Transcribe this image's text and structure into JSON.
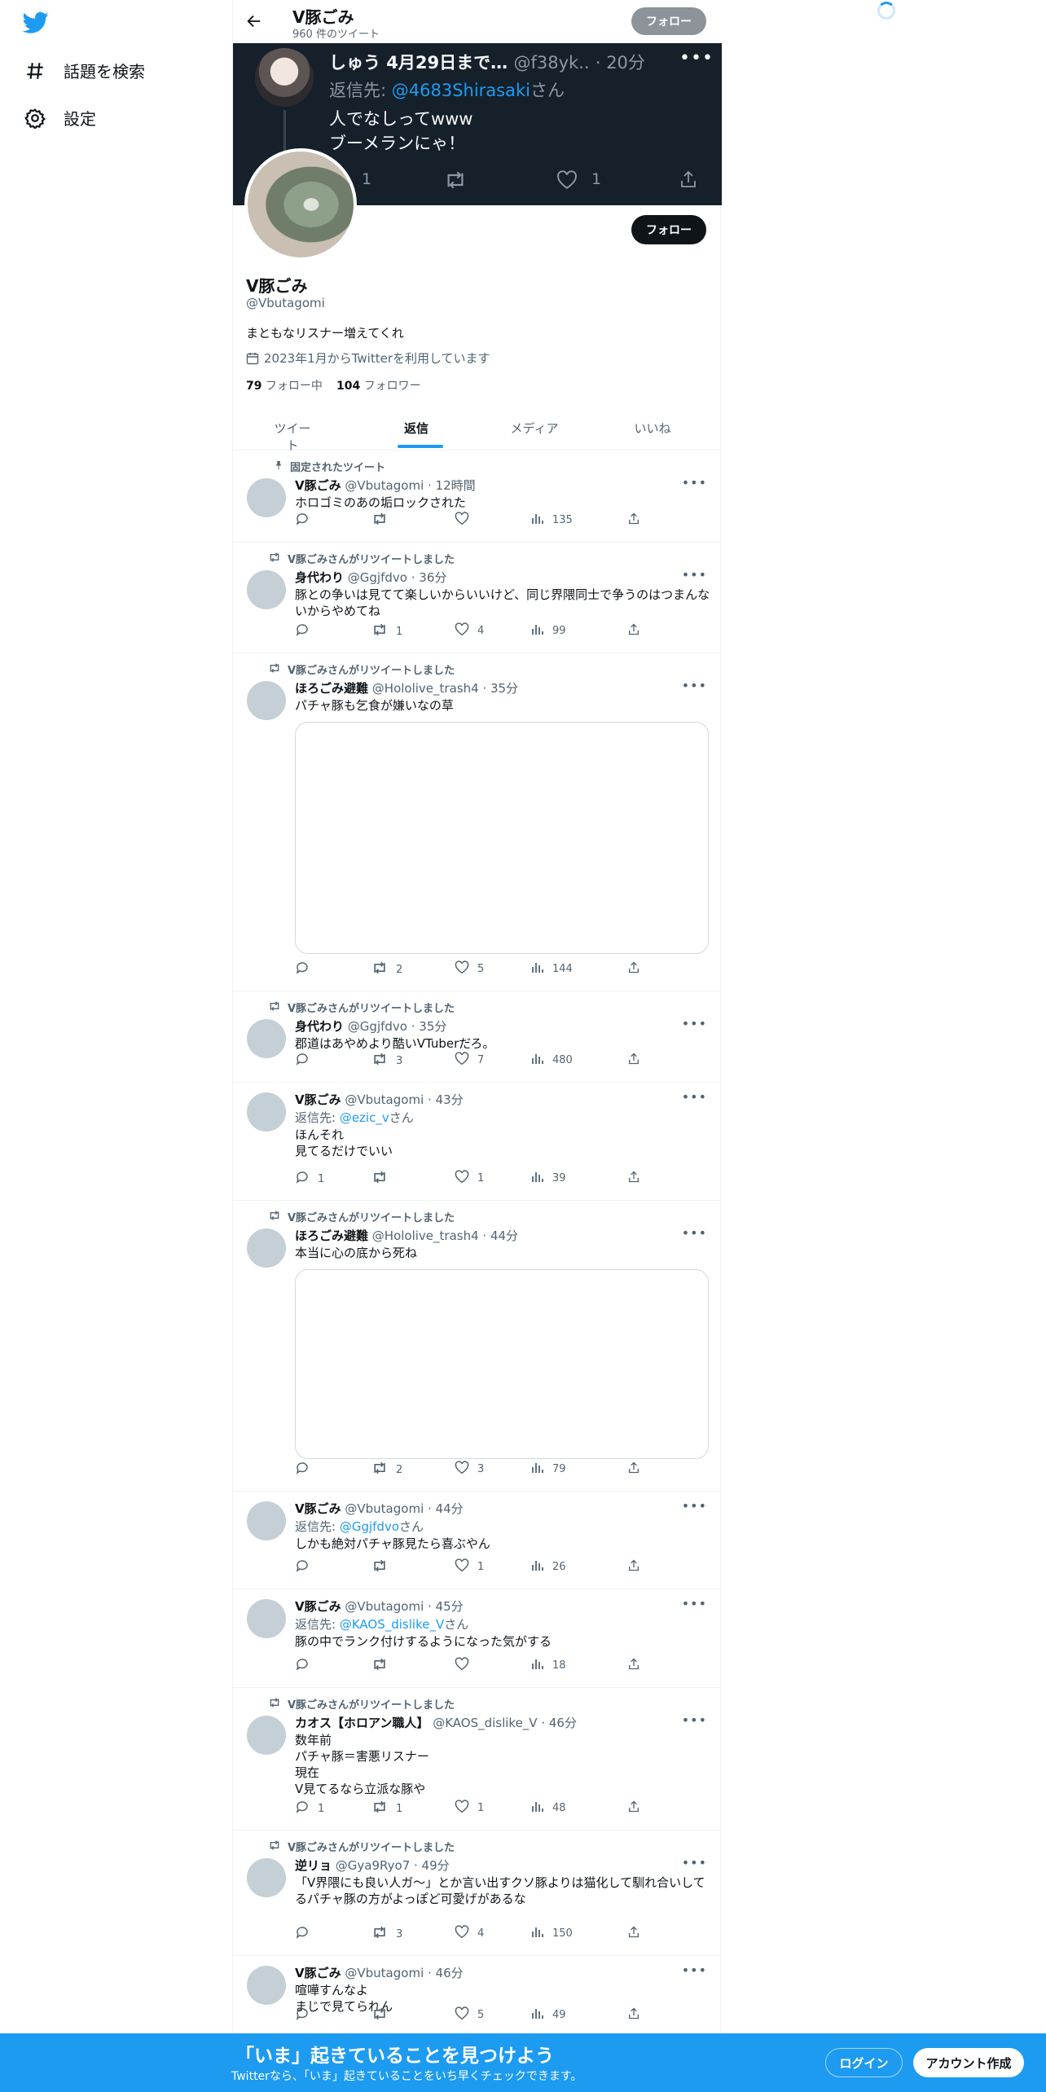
{
  "nav": {
    "explore_label": "話題を検索",
    "settings_label": "設定"
  },
  "header": {
    "name": "V豚ごみ",
    "tweet_count": "960 件のツイート",
    "follow_label": "フォロー"
  },
  "banner_tweet": {
    "name": "しゅう 4月29日まで…",
    "handle": "@f38yk..",
    "time": "· 20分",
    "reply_prefix": "返信先: ",
    "reply_to": "@4683Shirasaki",
    "reply_suffix": "さん",
    "line1": "人でなしってwww",
    "line2": "ブーメランにゃ！",
    "reply_count": "1",
    "like_count": "1"
  },
  "profile": {
    "follow_label": "フォロー",
    "name": "V豚ごみ",
    "handle": "@Vbutagomi",
    "bio": "まともなリスナー増えてくれ",
    "joined": "2023年1月からTwitterを利用しています",
    "following_count": "79",
    "following_label": "フォロー中",
    "followers_count": "104",
    "followers_label": "フォロワー"
  },
  "tabs": [
    "ツイート",
    "返信",
    "メディア",
    "いいね"
  ],
  "active_tab": "返信",
  "tweets": [
    {
      "context": "固定されたツイート",
      "name": "V豚ごみ",
      "meta": "@Vbutagomi · 12時間",
      "text": "ホロゴミのあの垢ロックされた",
      "replies": "",
      "retweets": "",
      "likes": "",
      "views": "135"
    },
    {
      "context": "V豚ごみさんがリツイートしました",
      "name": "身代わり",
      "meta": "@Ggjfdvo · 36分",
      "text": "豚との争いは見てて楽しいからいいけど、同じ界隈同士で争うのはつまんないからやめてね",
      "replies": "",
      "retweets": "1",
      "likes": "4",
      "views": "99"
    },
    {
      "context": "V豚ごみさんがリツイートしました",
      "name": "ほろごみ避難",
      "meta": "@Hololive_trash4 · 35分",
      "text": "パチャ豚も乞食が嫌いなの草",
      "replies": "",
      "retweets": "2",
      "likes": "5",
      "views": "144"
    },
    {
      "context": "V豚ごみさんがリツイートしました",
      "name": "身代わり",
      "meta": "@Ggjfdvo · 35分",
      "text": "郡道はあやめより酷いVTuberだろ。",
      "replies": "",
      "retweets": "3",
      "likes": "7",
      "views": "480"
    },
    {
      "context": "",
      "name": "V豚ごみ",
      "meta": "@Vbutagomi · 43分",
      "reply_prefix": "返信先: ",
      "reply_to": "@ezic_v",
      "reply_suffix": "さん",
      "text": "ほんそれ\n見てるだけでいい",
      "replies": "1",
      "retweets": "",
      "likes": "1",
      "views": "39"
    },
    {
      "context": "V豚ごみさんがリツイートしました",
      "name": "ほろごみ避難",
      "meta": "@Hololive_trash4 · 44分",
      "text": "本当に心の底から死ね",
      "replies": "",
      "retweets": "2",
      "likes": "3",
      "views": "79"
    },
    {
      "context": "",
      "name": "V豚ごみ",
      "meta": "@Vbutagomi · 44分",
      "reply_prefix": "返信先: ",
      "reply_to": "@Ggjfdvo",
      "reply_suffix": "さん",
      "text": "しかも絶対パチャ豚見たら喜ぶやん",
      "replies": "",
      "retweets": "",
      "likes": "1",
      "views": "26"
    },
    {
      "context": "",
      "name": "V豚ごみ",
      "meta": "@Vbutagomi · 45分",
      "reply_prefix": "返信先: ",
      "reply_to": "@KAOS_dislike_V",
      "reply_suffix": "さん",
      "text": "豚の中でランク付けするようになった気がする",
      "replies": "",
      "retweets": "",
      "likes": "",
      "views": "18"
    },
    {
      "context": "V豚ごみさんがリツイートしました",
      "name": "カオス【ホロアン職人】",
      "meta": "@KAOS_dislike_V · 46分",
      "text": "数年前\nパチャ豚＝害悪リスナー\n現在\nV見てるなら立派な豚や",
      "replies": "1",
      "retweets": "1",
      "likes": "1",
      "views": "48"
    },
    {
      "context": "V豚ごみさんがリツイートしました",
      "name": "逆リョ",
      "meta": "@Gya9Ryo7 · 49分",
      "text": "「V界隈にも良い人ガ～」とか言い出すクソ豚よりは猫化して馴れ合いしてるパチャ豚の方がよっぽど可愛げがあるな",
      "replies": "",
      "retweets": "3",
      "likes": "4",
      "views": "150"
    },
    {
      "context": "",
      "name": "V豚ごみ",
      "meta": "@Vbutagomi · 46分",
      "text": "喧嘩すんなよ\nまじで見てられん",
      "replies": "",
      "retweets": "",
      "likes": "5",
      "views": "49"
    }
  ],
  "bottom_bar": {
    "headline": "「いま」起きていることを見つけよう",
    "subtext": "Twitterなら、「いま」起きていることをいち早くチェックできます。",
    "login_label": "ログイン",
    "signup_label": "アカウント作成"
  },
  "colors": {
    "accent": "#1d9bf0",
    "banner_bg": "#15202b",
    "text": "#0f1419",
    "secondary": "#536471"
  }
}
